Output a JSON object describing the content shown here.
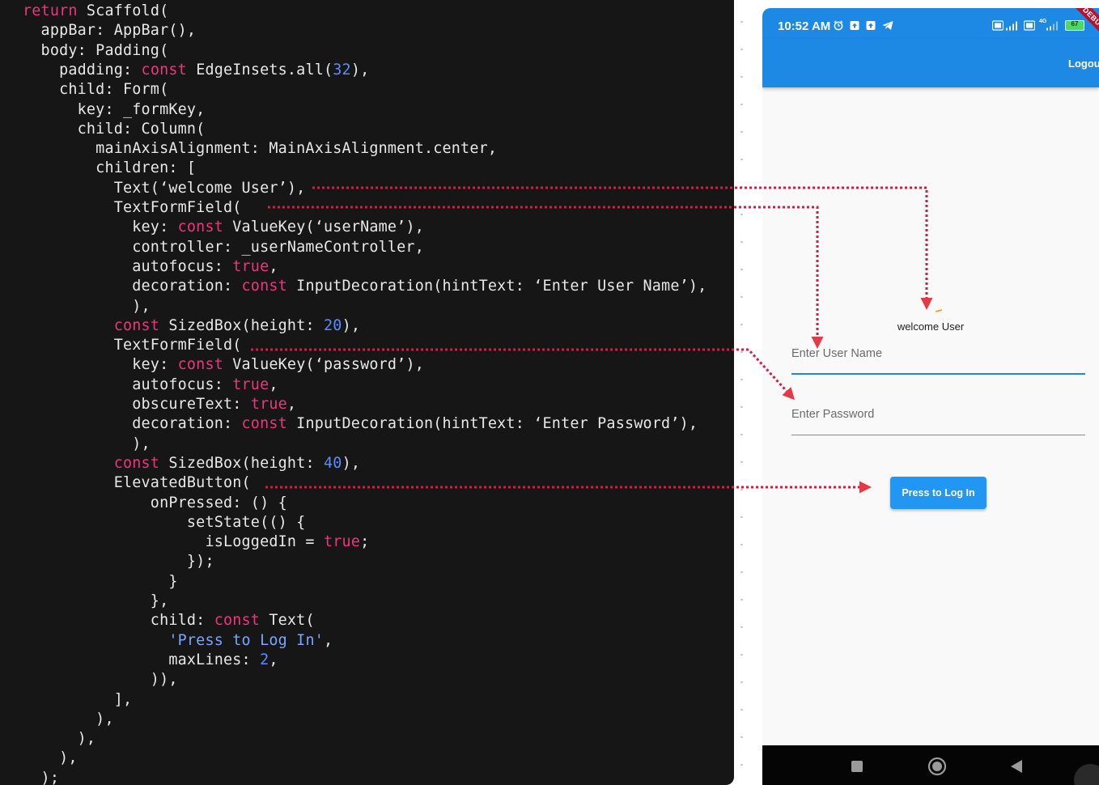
{
  "code": {
    "lines": [
      [
        {
          "t": "return",
          "c": "kw"
        },
        {
          "t": " Scaffold("
        }
      ],
      [
        {
          "t": "  appBar: AppBar(),"
        }
      ],
      [
        {
          "t": "  body: Padding("
        }
      ],
      [
        {
          "t": "    padding: "
        },
        {
          "t": "const",
          "c": "kw"
        },
        {
          "t": " EdgeInsets.all("
        },
        {
          "t": "32",
          "c": "num"
        },
        {
          "t": "),"
        }
      ],
      [
        {
          "t": "    child: Form("
        }
      ],
      [
        {
          "t": "      key: _formKey,"
        }
      ],
      [
        {
          "t": "      child: Column("
        }
      ],
      [
        {
          "t": "        mainAxisAlignment: MainAxisAlignment.center,"
        }
      ],
      [
        {
          "t": "        children: ["
        }
      ],
      [
        {
          "t": "          Text(‘welcome User’),"
        }
      ],
      [
        {
          "t": "          TextFormField("
        }
      ],
      [
        {
          "t": "            key: "
        },
        {
          "t": "const",
          "c": "kw"
        },
        {
          "t": " ValueKey(‘userName’),"
        }
      ],
      [
        {
          "t": "            controller: _userNameController,"
        }
      ],
      [
        {
          "t": "            autofocus: "
        },
        {
          "t": "true",
          "c": "kw"
        },
        {
          "t": ","
        }
      ],
      [
        {
          "t": "            decoration: "
        },
        {
          "t": "const",
          "c": "kw"
        },
        {
          "t": " InputDecoration(hintText: ‘Enter User Name’),"
        }
      ],
      [
        {
          "t": "            ),"
        }
      ],
      [
        {
          "t": "          "
        },
        {
          "t": "const",
          "c": "kw"
        },
        {
          "t": " SizedBox(height: "
        },
        {
          "t": "20",
          "c": "num"
        },
        {
          "t": "),"
        }
      ],
      [
        {
          "t": "          TextFormField("
        }
      ],
      [
        {
          "t": "            key: "
        },
        {
          "t": "const",
          "c": "kw"
        },
        {
          "t": " ValueKey(‘password’),"
        }
      ],
      [
        {
          "t": "            autofocus: "
        },
        {
          "t": "true",
          "c": "kw"
        },
        {
          "t": ","
        }
      ],
      [
        {
          "t": "            obscureText: "
        },
        {
          "t": "true",
          "c": "kw"
        },
        {
          "t": ","
        }
      ],
      [
        {
          "t": "            decoration: "
        },
        {
          "t": "const",
          "c": "kw"
        },
        {
          "t": " InputDecoration(hintText: ‘Enter Password’),"
        }
      ],
      [
        {
          "t": "            ),"
        }
      ],
      [
        {
          "t": "          "
        },
        {
          "t": "const",
          "c": "kw"
        },
        {
          "t": " SizedBox(height: "
        },
        {
          "t": "40",
          "c": "num"
        },
        {
          "t": "),"
        }
      ],
      [
        {
          "t": "          ElevatedButton("
        }
      ],
      [
        {
          "t": "              onPressed: () {"
        }
      ],
      [
        {
          "t": "                  setState(() {"
        }
      ],
      [
        {
          "t": "                    isLoggedIn = "
        },
        {
          "t": "true",
          "c": "kw"
        },
        {
          "t": ";"
        }
      ],
      [
        {
          "t": "                  });"
        }
      ],
      [
        {
          "t": "                }"
        }
      ],
      [
        {
          "t": "              },"
        }
      ],
      [
        {
          "t": "              child: "
        },
        {
          "t": "const",
          "c": "kw"
        },
        {
          "t": " Text("
        }
      ],
      [
        {
          "t": "                "
        },
        {
          "t": "'Press to Log In'",
          "c": "str"
        },
        {
          "t": ","
        }
      ],
      [
        {
          "t": "                maxLines: "
        },
        {
          "t": "2",
          "c": "num"
        },
        {
          "t": ","
        }
      ],
      [
        {
          "t": "              )),"
        }
      ],
      [
        {
          "t": "          ],"
        }
      ],
      [
        {
          "t": "        ),"
        }
      ],
      [
        {
          "t": "      ),"
        }
      ],
      [
        {
          "t": "    ),"
        }
      ],
      [
        {
          "t": "  );"
        }
      ]
    ]
  },
  "phone": {
    "status_time": "10:52 AM",
    "network_label": "4G",
    "battery_level": "67",
    "debug_banner": "DEBUG",
    "logout_label": "Logout",
    "welcome_text": "welcome User",
    "username_placeholder": "Enter User Name",
    "password_placeholder": "Enter Password",
    "login_button_label": "Press to Log In"
  },
  "colors": {
    "code_bg": "#161616",
    "keyword": "#f0357a",
    "number": "#5a8cff",
    "app_bar": "#1e88e5",
    "button": "#2196f3",
    "arrow": "#e53945"
  },
  "icons": [
    "alarm-icon",
    "upload-icon",
    "telegram-icon",
    "signal-icon",
    "battery-icon",
    "square-nav-icon",
    "circle-nav-icon",
    "back-nav-icon"
  ]
}
